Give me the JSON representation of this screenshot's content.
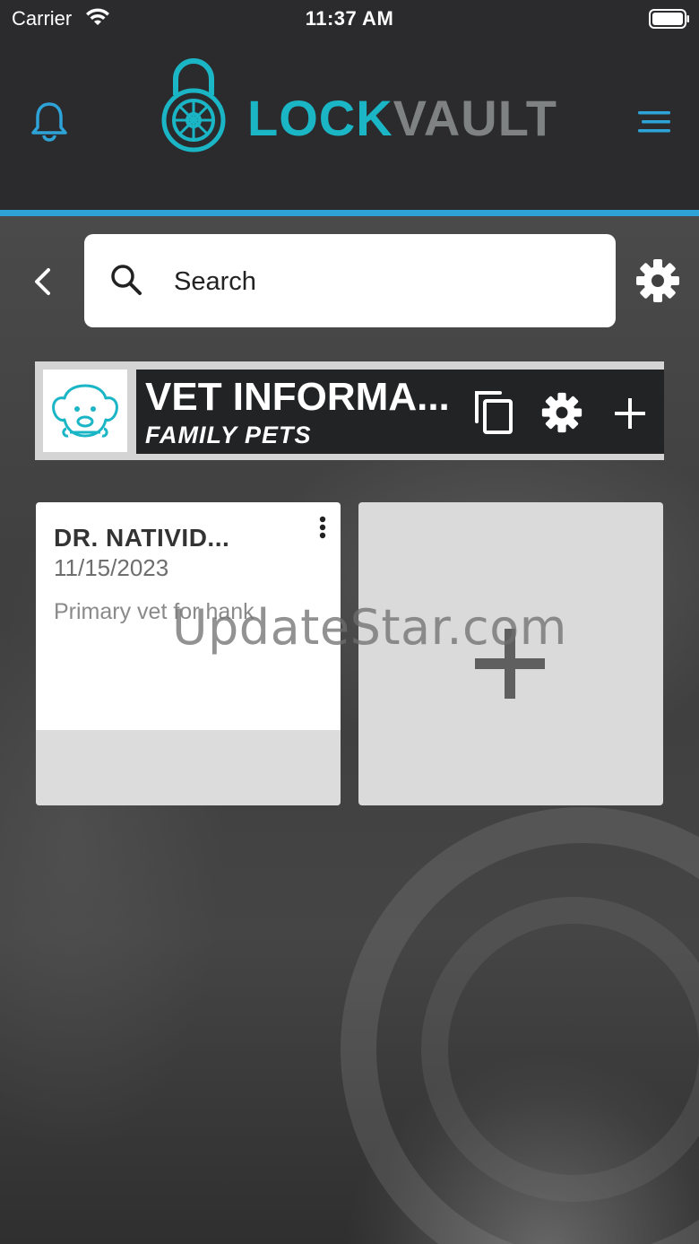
{
  "status_bar": {
    "carrier": "Carrier",
    "time": "11:37 AM"
  },
  "header": {
    "logo_lock": "LOCK",
    "logo_vault": "VAULT",
    "icons": {
      "left": "bell-icon",
      "right": "hamburger-menu-icon"
    },
    "accent_color": "#2ea3d8",
    "brand_color": "#1bb6c6"
  },
  "search": {
    "placeholder": "Search",
    "value": ""
  },
  "category": {
    "title": "VET INFORMA...",
    "subtitle": "FAMILY PETS",
    "image": "dog-icon"
  },
  "cards": [
    {
      "title": "DR. NATIVID...",
      "date": "11/15/2023",
      "description": "Primary vet for hank"
    }
  ],
  "watermark": "UpdateStar.com"
}
